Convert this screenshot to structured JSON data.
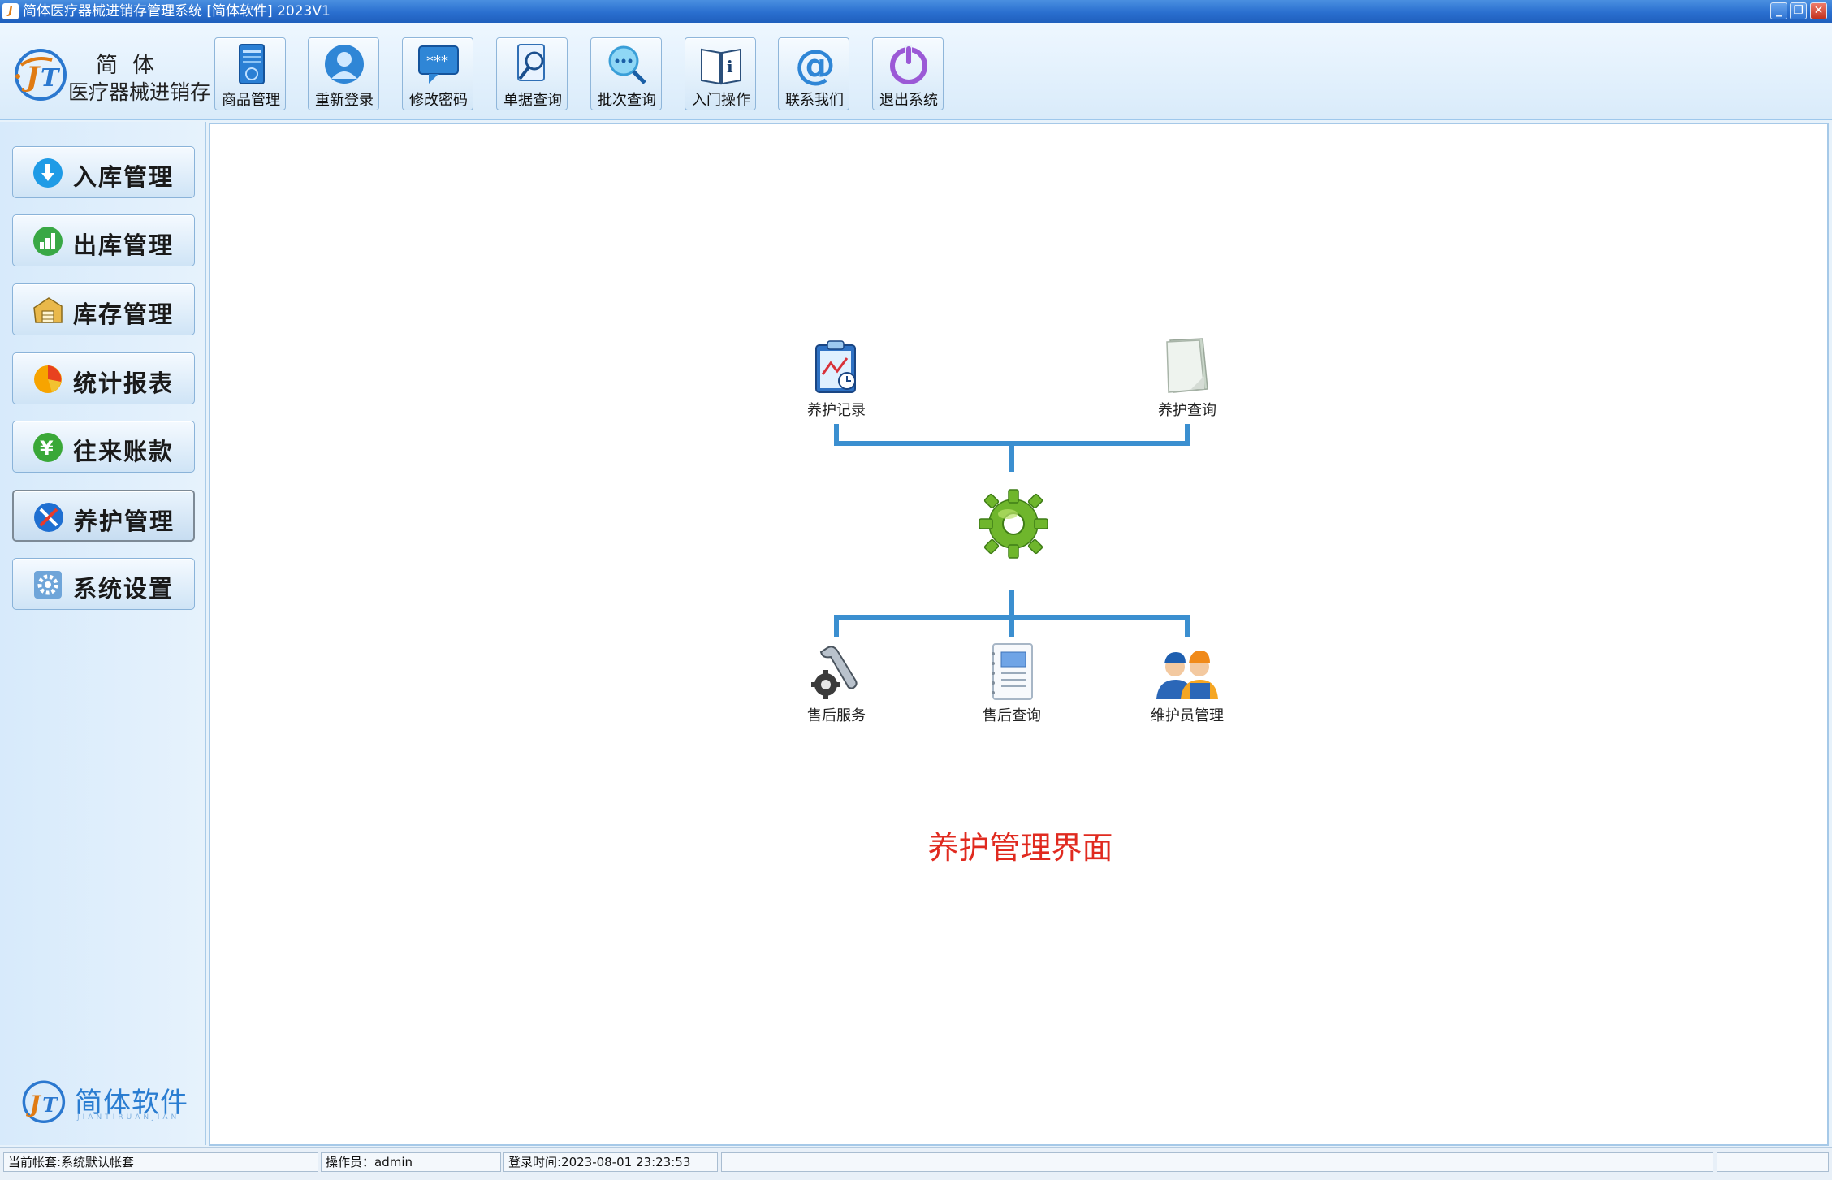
{
  "window": {
    "title": "简体医疗器械进销存管理系统 [简体软件] 2023V1",
    "controls": {
      "minimize": "_",
      "maximize": "❐",
      "close": "✕"
    }
  },
  "brand": {
    "line1": "简体",
    "line2": "医疗器械进销存"
  },
  "toolbar": {
    "items": [
      {
        "label": "商品管理",
        "icon": "book-icon"
      },
      {
        "label": "重新登录",
        "icon": "user-icon"
      },
      {
        "label": "修改密码",
        "icon": "password-icon"
      },
      {
        "label": "单据查询",
        "icon": "document-search-icon"
      },
      {
        "label": "批次查询",
        "icon": "search-icon"
      },
      {
        "label": "入门操作",
        "icon": "manual-icon"
      },
      {
        "label": "联系我们",
        "icon": "at-icon"
      },
      {
        "label": "退出系统",
        "icon": "power-icon"
      }
    ]
  },
  "sidebar": {
    "items": [
      {
        "label": "入库管理",
        "icon": "arrow-down-icon"
      },
      {
        "label": "出库管理",
        "icon": "bar-chart-icon"
      },
      {
        "label": "库存管理",
        "icon": "warehouse-icon"
      },
      {
        "label": "统计报表",
        "icon": "pie-chart-icon"
      },
      {
        "label": "往来账款",
        "icon": "yen-icon"
      },
      {
        "label": "养护管理",
        "icon": "tools-icon",
        "active": true
      },
      {
        "label": "系统设置",
        "icon": "gear-icon"
      }
    ],
    "footer_brand": "简体软件",
    "footer_brand_sub": "JIANTIRUANJIAN"
  },
  "main": {
    "top_nodes": [
      {
        "label": "养护记录",
        "icon": "clipboard-chart-icon"
      },
      {
        "label": "养护查询",
        "icon": "paper-icon"
      }
    ],
    "hub_icon": "green-gear-icon",
    "bottom_nodes": [
      {
        "label": "售后服务",
        "icon": "wrench-gear-icon"
      },
      {
        "label": "售后查询",
        "icon": "notebook-icon"
      },
      {
        "label": "维护员管理",
        "icon": "workers-icon"
      }
    ],
    "caption": "养护管理界面",
    "colors": {
      "line": "#3b8fd0",
      "caption": "#e02a1f"
    }
  },
  "statusbar": {
    "account": "当前帐套:系统默认帐套",
    "operator": "操作员：admin",
    "login_time": "登录时间:2023-08-01 23:23:53"
  }
}
